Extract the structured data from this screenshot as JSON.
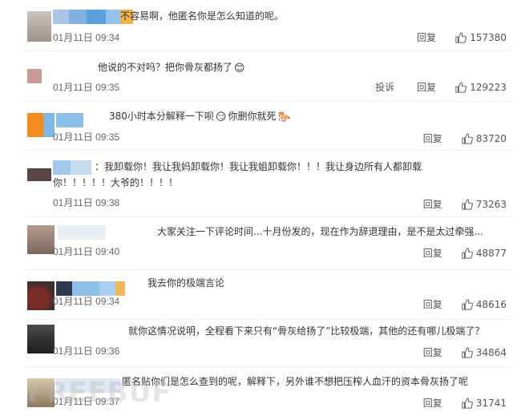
{
  "comments": [
    {
      "text": "不容易啊，他匿名你是怎么知道的呢。",
      "date": "01月11日 09:34",
      "reply": "回复",
      "likes": "157380",
      "emoji": ""
    },
    {
      "text": "他说的不对吗？把你骨灰都扬了",
      "date": "01月11日 09:35",
      "report": "投诉",
      "reply": "回复",
      "likes": "129223",
      "emoji": "😊"
    },
    {
      "text": "380小时本分解释一下呗",
      "text_b": "你删你就死",
      "date": "01月11日 09:35",
      "reply": "回复",
      "likes": "83720",
      "emoji": "😏",
      "emoji_b": "🐎"
    },
    {
      "text": "：我卸载你！我让我妈卸载你！我让我姐卸载你！！！我让身边所有人都卸载你！！！！！大爷的！！！！",
      "date": "01月11日 09:38",
      "reply": "回复",
      "likes": "73263"
    },
    {
      "text": "大家关注一下评论时间...十月份发的，现在作为辞退理由，是不是太过牵强...",
      "date": "01月11日 09:40",
      "reply": "回复",
      "likes": "48877"
    },
    {
      "text": "我去你的极端言论",
      "date": "01月11日 09:34",
      "reply": "回复",
      "likes": "48616"
    },
    {
      "text": "就你这情况说明，全程看下来只有“骨灰给扬了”比较极端，其他的还有哪儿极端了？",
      "date": "01月11日 09:36",
      "reply": "回复",
      "likes": "34864"
    },
    {
      "text": "匿名贴你们是怎么查到的呢，解释下，另外谁不想把压榨人血汗的资本骨灰扬了呢",
      "date": "01月11日 09:37",
      "reply": "回复",
      "likes": "31741"
    }
  ],
  "watermark": "FREEBUF",
  "icons": {
    "like": "thumbs-up-icon"
  }
}
